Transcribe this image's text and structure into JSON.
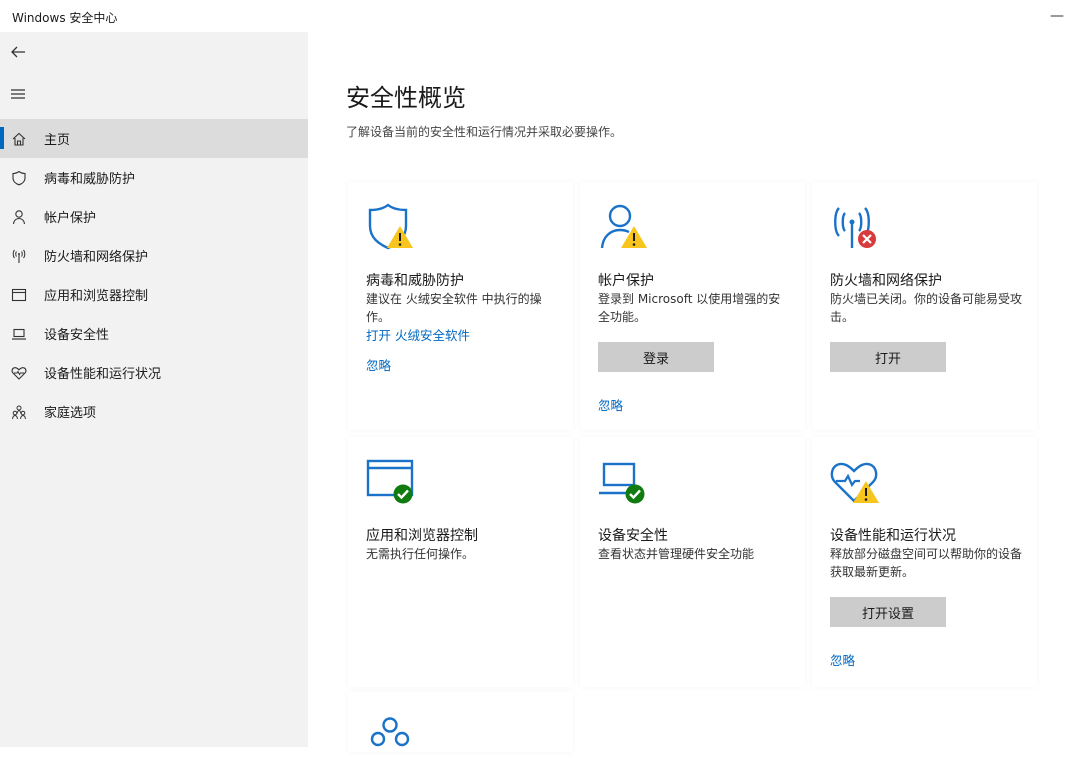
{
  "window": {
    "title": "Windows 安全中心",
    "minimize_glyph": "—"
  },
  "sidebar": {
    "back_icon": "back-arrow-icon",
    "menu_icon": "hamburger-menu-icon",
    "items": [
      {
        "label": "主页",
        "icon": "home-icon",
        "active": true
      },
      {
        "label": "病毒和威胁防护",
        "icon": "shield-icon"
      },
      {
        "label": "帐户保护",
        "icon": "person-icon"
      },
      {
        "label": "防火墙和网络保护",
        "icon": "wireless-icon"
      },
      {
        "label": "应用和浏览器控制",
        "icon": "browser-window-icon"
      },
      {
        "label": "设备安全性",
        "icon": "laptop-icon"
      },
      {
        "label": "设备性能和运行状况",
        "icon": "heart-pulse-icon"
      },
      {
        "label": "家庭选项",
        "icon": "family-icon"
      }
    ]
  },
  "main": {
    "title": "安全性概览",
    "subtitle": "了解设备当前的安全性和运行情况并采取必要操作。",
    "cards": {
      "virus": {
        "title": "病毒和威胁防护",
        "desc": "建议在 火绒安全软件 中执行的操作。",
        "action_link": "打开 火绒安全软件",
        "dismiss": "忽略",
        "icon": "shield-warning-icon"
      },
      "account": {
        "title": "帐户保护",
        "desc": "登录到 Microsoft 以使用增强的安全功能。",
        "button": "登录",
        "dismiss": "忽略",
        "icon": "person-warning-icon"
      },
      "firewall": {
        "title": "防火墙和网络保护",
        "desc": "防火墙已关闭。你的设备可能易受攻击。",
        "button": "打开",
        "icon": "wireless-error-icon"
      },
      "app": {
        "title": "应用和浏览器控制",
        "desc": "无需执行任何操作。",
        "icon": "browser-check-icon"
      },
      "device": {
        "title": "设备安全性",
        "desc": "查看状态并管理硬件安全功能",
        "icon": "laptop-check-icon"
      },
      "health": {
        "title": "设备性能和运行状况",
        "desc": "释放部分磁盘空间可以帮助你的设备获取最新更新。",
        "button": "打开设置",
        "dismiss": "忽略",
        "icon": "heart-warning-icon"
      },
      "family": {
        "icon": "family-icon"
      }
    }
  },
  "colors": {
    "accent": "#0067c0",
    "icon_blue": "#1a73c8",
    "warning": "#f7c51e",
    "error": "#d83b3b",
    "success": "#107c10",
    "sidebar_bg": "#f2f2f2",
    "active_bg": "#dcdcdc",
    "button_bg": "#cccccc"
  }
}
